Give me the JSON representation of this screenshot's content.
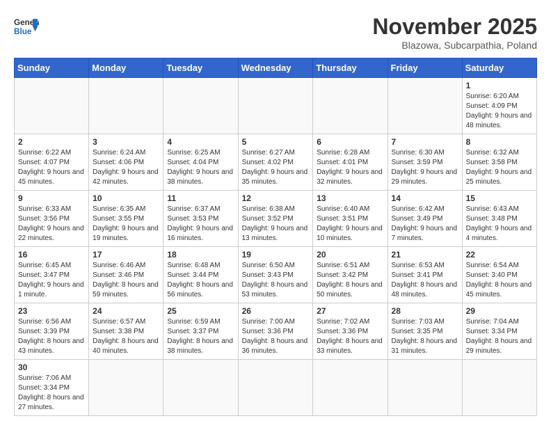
{
  "header": {
    "logo_general": "General",
    "logo_blue": "Blue",
    "month_title": "November 2025",
    "subtitle": "Blazowa, Subcarpathia, Poland"
  },
  "days_of_week": [
    "Sunday",
    "Monday",
    "Tuesday",
    "Wednesday",
    "Thursday",
    "Friday",
    "Saturday"
  ],
  "weeks": [
    [
      {
        "day": "",
        "info": ""
      },
      {
        "day": "",
        "info": ""
      },
      {
        "day": "",
        "info": ""
      },
      {
        "day": "",
        "info": ""
      },
      {
        "day": "",
        "info": ""
      },
      {
        "day": "",
        "info": ""
      },
      {
        "day": "1",
        "info": "Sunrise: 6:20 AM\nSunset: 4:09 PM\nDaylight: 9 hours and 48 minutes."
      }
    ],
    [
      {
        "day": "2",
        "info": "Sunrise: 6:22 AM\nSunset: 4:07 PM\nDaylight: 9 hours and 45 minutes."
      },
      {
        "day": "3",
        "info": "Sunrise: 6:24 AM\nSunset: 4:06 PM\nDaylight: 9 hours and 42 minutes."
      },
      {
        "day": "4",
        "info": "Sunrise: 6:25 AM\nSunset: 4:04 PM\nDaylight: 9 hours and 38 minutes."
      },
      {
        "day": "5",
        "info": "Sunrise: 6:27 AM\nSunset: 4:02 PM\nDaylight: 9 hours and 35 minutes."
      },
      {
        "day": "6",
        "info": "Sunrise: 6:28 AM\nSunset: 4:01 PM\nDaylight: 9 hours and 32 minutes."
      },
      {
        "day": "7",
        "info": "Sunrise: 6:30 AM\nSunset: 3:59 PM\nDaylight: 9 hours and 29 minutes."
      },
      {
        "day": "8",
        "info": "Sunrise: 6:32 AM\nSunset: 3:58 PM\nDaylight: 9 hours and 25 minutes."
      }
    ],
    [
      {
        "day": "9",
        "info": "Sunrise: 6:33 AM\nSunset: 3:56 PM\nDaylight: 9 hours and 22 minutes."
      },
      {
        "day": "10",
        "info": "Sunrise: 6:35 AM\nSunset: 3:55 PM\nDaylight: 9 hours and 19 minutes."
      },
      {
        "day": "11",
        "info": "Sunrise: 6:37 AM\nSunset: 3:53 PM\nDaylight: 9 hours and 16 minutes."
      },
      {
        "day": "12",
        "info": "Sunrise: 6:38 AM\nSunset: 3:52 PM\nDaylight: 9 hours and 13 minutes."
      },
      {
        "day": "13",
        "info": "Sunrise: 6:40 AM\nSunset: 3:51 PM\nDaylight: 9 hours and 10 minutes."
      },
      {
        "day": "14",
        "info": "Sunrise: 6:42 AM\nSunset: 3:49 PM\nDaylight: 9 hours and 7 minutes."
      },
      {
        "day": "15",
        "info": "Sunrise: 6:43 AM\nSunset: 3:48 PM\nDaylight: 9 hours and 4 minutes."
      }
    ],
    [
      {
        "day": "16",
        "info": "Sunrise: 6:45 AM\nSunset: 3:47 PM\nDaylight: 9 hours and 1 minute."
      },
      {
        "day": "17",
        "info": "Sunrise: 6:46 AM\nSunset: 3:46 PM\nDaylight: 8 hours and 59 minutes."
      },
      {
        "day": "18",
        "info": "Sunrise: 6:48 AM\nSunset: 3:44 PM\nDaylight: 8 hours and 56 minutes."
      },
      {
        "day": "19",
        "info": "Sunrise: 6:50 AM\nSunset: 3:43 PM\nDaylight: 8 hours and 53 minutes."
      },
      {
        "day": "20",
        "info": "Sunrise: 6:51 AM\nSunset: 3:42 PM\nDaylight: 8 hours and 50 minutes."
      },
      {
        "day": "21",
        "info": "Sunrise: 6:53 AM\nSunset: 3:41 PM\nDaylight: 8 hours and 48 minutes."
      },
      {
        "day": "22",
        "info": "Sunrise: 6:54 AM\nSunset: 3:40 PM\nDaylight: 8 hours and 45 minutes."
      }
    ],
    [
      {
        "day": "23",
        "info": "Sunrise: 6:56 AM\nSunset: 3:39 PM\nDaylight: 8 hours and 43 minutes."
      },
      {
        "day": "24",
        "info": "Sunrise: 6:57 AM\nSunset: 3:38 PM\nDaylight: 8 hours and 40 minutes."
      },
      {
        "day": "25",
        "info": "Sunrise: 6:59 AM\nSunset: 3:37 PM\nDaylight: 8 hours and 38 minutes."
      },
      {
        "day": "26",
        "info": "Sunrise: 7:00 AM\nSunset: 3:36 PM\nDaylight: 8 hours and 36 minutes."
      },
      {
        "day": "27",
        "info": "Sunrise: 7:02 AM\nSunset: 3:36 PM\nDaylight: 8 hours and 33 minutes."
      },
      {
        "day": "28",
        "info": "Sunrise: 7:03 AM\nSunset: 3:35 PM\nDaylight: 8 hours and 31 minutes."
      },
      {
        "day": "29",
        "info": "Sunrise: 7:04 AM\nSunset: 3:34 PM\nDaylight: 8 hours and 29 minutes."
      }
    ],
    [
      {
        "day": "30",
        "info": "Sunrise: 7:06 AM\nSunset: 3:34 PM\nDaylight: 8 hours and 27 minutes."
      },
      {
        "day": "",
        "info": ""
      },
      {
        "day": "",
        "info": ""
      },
      {
        "day": "",
        "info": ""
      },
      {
        "day": "",
        "info": ""
      },
      {
        "day": "",
        "info": ""
      },
      {
        "day": "",
        "info": ""
      }
    ]
  ]
}
